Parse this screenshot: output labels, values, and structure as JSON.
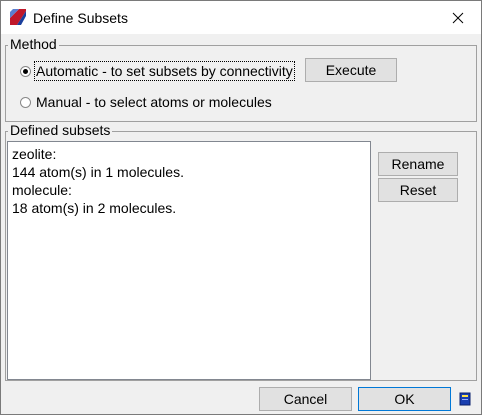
{
  "window": {
    "title": "Define Subsets"
  },
  "method": {
    "group_label": "Method",
    "automatic_label": "Automatic - to set subsets by connectivity",
    "manual_label": "Manual - to select atoms or molecules",
    "selected": "automatic",
    "execute_label": "Execute"
  },
  "subsets": {
    "group_label": "Defined subsets",
    "lines": [
      "zeolite:",
      "144 atom(s) in 1 molecules.",
      "molecule:",
      "18 atom(s) in 2 molecules."
    ],
    "rename_label": "Rename",
    "reset_label": "Reset"
  },
  "footer": {
    "cancel_label": "Cancel",
    "ok_label": "OK"
  },
  "colors": {
    "accent": "#0078d7",
    "window_bg": "#f0f0f0"
  }
}
